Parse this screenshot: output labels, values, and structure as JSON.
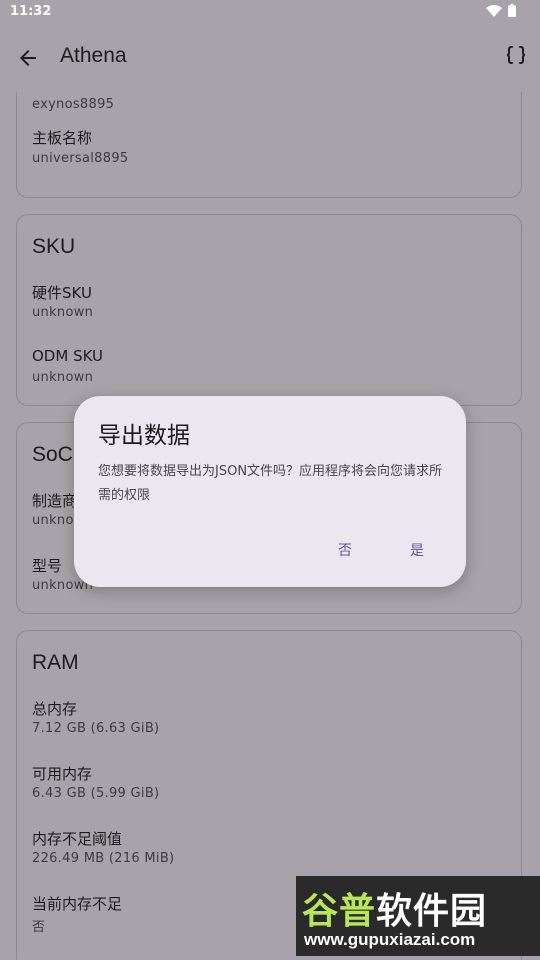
{
  "status": {
    "time": "11:32"
  },
  "app_bar": {
    "title": "Athena"
  },
  "cards": {
    "board": {
      "items": [
        {
          "value": "exynos8895"
        },
        {
          "label": "主板名称",
          "value": "universal8895"
        }
      ]
    },
    "sku": {
      "title": "SKU",
      "items": [
        {
          "label": "硬件SKU",
          "value": "unknown"
        },
        {
          "label": "ODM SKU",
          "value": "unknown"
        }
      ]
    },
    "soc": {
      "title": "SoC",
      "items": [
        {
          "label": "制造商",
          "value": "unknown"
        },
        {
          "label": "型号",
          "value": "unknown"
        }
      ]
    },
    "ram": {
      "title": "RAM",
      "items": [
        {
          "label": "总内存",
          "value": "7.12 GB (6.63 GiB)"
        },
        {
          "label": "可用内存",
          "value": "6.43 GB (5.99 GiB)"
        },
        {
          "label": "内存不足阈值",
          "value": "226.49 MB (216 MiB)"
        },
        {
          "label": "当前内存不足",
          "value": "否"
        }
      ]
    }
  },
  "dialog": {
    "title": "导出数据",
    "message": "您想要将数据导出为JSON文件吗？应用程序将会向您请求所需的权限",
    "no_label": "否",
    "yes_label": "是"
  },
  "watermark": {
    "line1_a": "谷普",
    "line1_b": "软件园",
    "line2": "www.gupuxiazai.com"
  },
  "colors": {
    "accent": "#65558f",
    "dialog_bg": "#ece6f0",
    "background": "#a8a3aa"
  }
}
